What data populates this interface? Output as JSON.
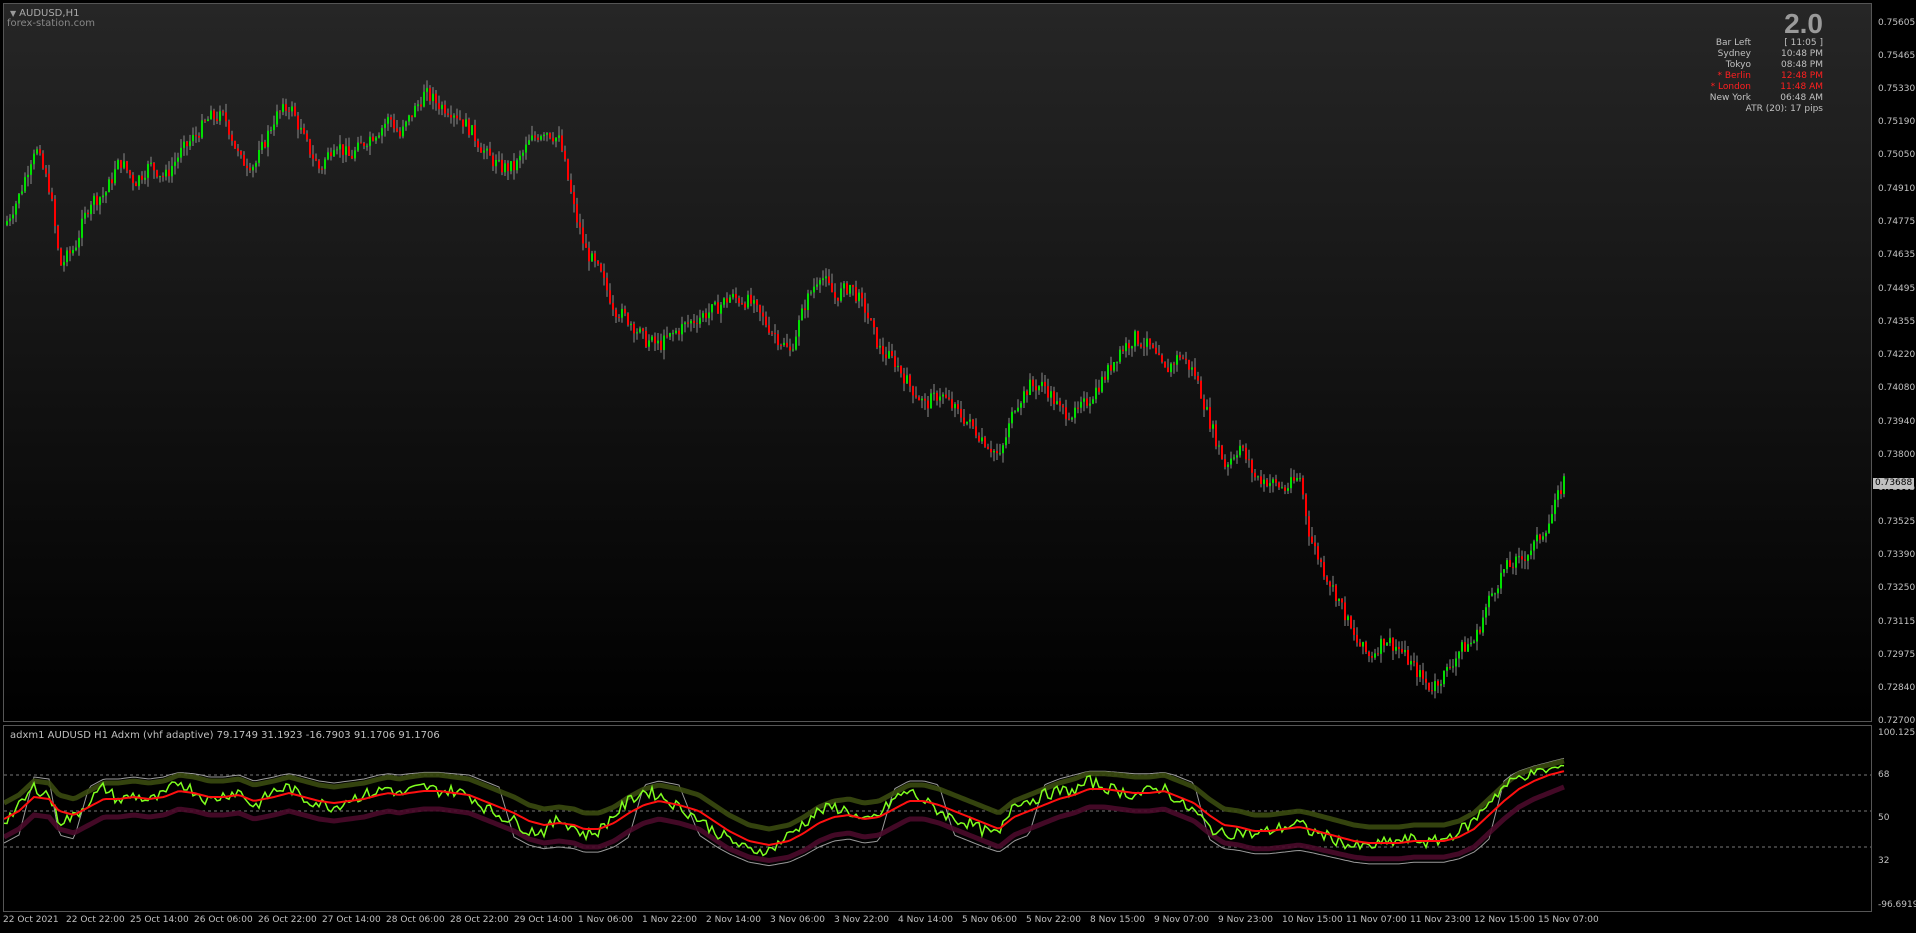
{
  "chart": {
    "symbol_title": "AUDUSD,H1",
    "site": "forex-station.com",
    "current_price": "0.73688",
    "price_axis": [
      "0.75605",
      "0.75465",
      "0.75330",
      "0.75190",
      "0.75050",
      "0.74910",
      "0.74775",
      "0.74635",
      "0.74495",
      "0.74355",
      "0.74220",
      "0.74080",
      "0.73940",
      "0.73800",
      "0.73665",
      "0.73525",
      "0.73390",
      "0.73250",
      "0.73115",
      "0.72975",
      "0.72840",
      "0.72700"
    ],
    "colors": {
      "up": "#00e000",
      "down": "#ff0000",
      "wick": "#888888",
      "grid": "#555555"
    }
  },
  "info_panel": {
    "big_value": "2.0",
    "rows": [
      {
        "label": "Bar Left",
        "value": "[ 11:05 ]",
        "color": "#c0c0c0"
      },
      {
        "label": "Sydney",
        "value": "10:48 PM",
        "color": "#c0c0c0"
      },
      {
        "label": "Tokyo",
        "value": "08:48 PM",
        "color": "#c0c0c0"
      },
      {
        "label": "* Berlin",
        "value": "12:48 PM",
        "color": "#ff2020"
      },
      {
        "label": "* London",
        "value": "11:48 AM",
        "color": "#ff2020"
      },
      {
        "label": "New York",
        "value": "06:48 AM",
        "color": "#c0c0c0"
      },
      {
        "label": "ATR (20): 17 pips",
        "value": "",
        "color": "#c0c0c0"
      }
    ]
  },
  "indicator": {
    "title": "adxm1 AUDUSD H1 Adxm (vhf adaptive) 79.1749 31.1923 -16.7903 91.1706 91.1706",
    "axis": [
      "100.1255",
      "68",
      "50",
      "32",
      "-96.6919"
    ],
    "levels": [
      68,
      50,
      32
    ],
    "colors": {
      "fast": "#80ff20",
      "slow": "#ff1010",
      "band_up": "#3a4a10",
      "band_dn": "#4a0a2a",
      "ref": "#9a9a9a"
    }
  },
  "time_axis": [
    "22 Oct 2021",
    "22 Oct 22:00",
    "25 Oct 14:00",
    "26 Oct 06:00",
    "26 Oct 22:00",
    "27 Oct 14:00",
    "28 Oct 06:00",
    "28 Oct 22:00",
    "29 Oct 14:00",
    "1 Nov 06:00",
    "1 Nov 22:00",
    "2 Nov 14:00",
    "3 Nov 06:00",
    "3 Nov 22:00",
    "4 Nov 14:00",
    "5 Nov 06:00",
    "5 Nov 22:00",
    "8 Nov 15:00",
    "9 Nov 07:00",
    "9 Nov 23:00",
    "10 Nov 15:00",
    "11 Nov 07:00",
    "11 Nov 23:00",
    "12 Nov 15:00",
    "15 Nov 07:00"
  ],
  "path_points": {
    "price": [
      [
        0,
        0.7475
      ],
      [
        15,
        0.7488
      ],
      [
        30,
        0.7508
      ],
      [
        45,
        0.749
      ],
      [
        55,
        0.7458
      ],
      [
        70,
        0.7466
      ],
      [
        85,
        0.7485
      ],
      [
        100,
        0.7488
      ],
      [
        115,
        0.7502
      ],
      [
        130,
        0.7493
      ],
      [
        145,
        0.75
      ],
      [
        160,
        0.7495
      ],
      [
        175,
        0.7505
      ],
      [
        190,
        0.7512
      ],
      [
        205,
        0.752
      ],
      [
        220,
        0.752
      ],
      [
        235,
        0.7502
      ],
      [
        250,
        0.75
      ],
      [
        270,
        0.752
      ],
      [
        285,
        0.7525
      ],
      [
        300,
        0.751
      ],
      [
        315,
        0.7498
      ],
      [
        330,
        0.751
      ],
      [
        345,
        0.7503
      ],
      [
        360,
        0.751
      ],
      [
        375,
        0.7515
      ],
      [
        385,
        0.752
      ],
      [
        395,
        0.7512
      ],
      [
        405,
        0.752
      ],
      [
        420,
        0.753
      ],
      [
        435,
        0.7525
      ],
      [
        450,
        0.7522
      ],
      [
        465,
        0.7515
      ],
      [
        480,
        0.7505
      ],
      [
        495,
        0.7499
      ],
      [
        510,
        0.7499
      ],
      [
        525,
        0.751
      ],
      [
        540,
        0.7515
      ],
      [
        555,
        0.751
      ],
      [
        570,
        0.748
      ],
      [
        580,
        0.7465
      ],
      [
        595,
        0.7455
      ],
      [
        610,
        0.744
      ],
      [
        625,
        0.7435
      ],
      [
        640,
        0.7427
      ],
      [
        655,
        0.7425
      ],
      [
        675,
        0.7432
      ],
      [
        695,
        0.7437
      ],
      [
        710,
        0.744
      ],
      [
        725,
        0.7445
      ],
      [
        745,
        0.7443
      ],
      [
        765,
        0.7432
      ],
      [
        785,
        0.7422
      ],
      [
        800,
        0.7442
      ],
      [
        815,
        0.7455
      ],
      [
        830,
        0.7445
      ],
      [
        845,
        0.745
      ],
      [
        860,
        0.744
      ],
      [
        875,
        0.7423
      ],
      [
        890,
        0.7418
      ],
      [
        905,
        0.7408
      ],
      [
        920,
        0.74
      ],
      [
        935,
        0.7405
      ],
      [
        950,
        0.7398
      ],
      [
        965,
        0.7392
      ],
      [
        980,
        0.7385
      ],
      [
        995,
        0.7378
      ],
      [
        1010,
        0.74
      ],
      [
        1025,
        0.7408
      ],
      [
        1040,
        0.7408
      ],
      [
        1055,
        0.7398
      ],
      [
        1070,
        0.7396
      ],
      [
        1085,
        0.7403
      ],
      [
        1100,
        0.7412
      ],
      [
        1115,
        0.7423
      ],
      [
        1130,
        0.7428
      ],
      [
        1145,
        0.7424
      ],
      [
        1160,
        0.7414
      ],
      [
        1175,
        0.7421
      ],
      [
        1190,
        0.7413
      ],
      [
        1205,
        0.7393
      ],
      [
        1220,
        0.7375
      ],
      [
        1235,
        0.7383
      ],
      [
        1250,
        0.737
      ],
      [
        1265,
        0.7368
      ],
      [
        1280,
        0.7365
      ],
      [
        1295,
        0.737
      ],
      [
        1305,
        0.7345
      ],
      [
        1320,
        0.733
      ],
      [
        1335,
        0.7318
      ],
      [
        1350,
        0.7302
      ],
      [
        1365,
        0.7295
      ],
      [
        1380,
        0.7303
      ],
      [
        1395,
        0.7298
      ],
      [
        1410,
        0.729
      ],
      [
        1425,
        0.7282
      ],
      [
        1440,
        0.7288
      ],
      [
        1455,
        0.7298
      ],
      [
        1470,
        0.7302
      ],
      [
        1485,
        0.732
      ],
      [
        1500,
        0.7332
      ],
      [
        1515,
        0.7335
      ],
      [
        1530,
        0.7342
      ],
      [
        1545,
        0.7352
      ],
      [
        1560,
        0.737
      ]
    ],
    "fast": [
      [
        0,
        45
      ],
      [
        15,
        52
      ],
      [
        30,
        62
      ],
      [
        45,
        58
      ],
      [
        55,
        45
      ],
      [
        70,
        47
      ],
      [
        85,
        55
      ],
      [
        100,
        62
      ],
      [
        115,
        55
      ],
      [
        130,
        58
      ],
      [
        145,
        55
      ],
      [
        160,
        58
      ],
      [
        175,
        65
      ],
      [
        190,
        60
      ],
      [
        205,
        55
      ],
      [
        220,
        58
      ],
      [
        235,
        60
      ],
      [
        250,
        52
      ],
      [
        270,
        60
      ],
      [
        285,
        62
      ],
      [
        300,
        56
      ],
      [
        315,
        54
      ],
      [
        330,
        52
      ],
      [
        345,
        56
      ],
      [
        360,
        58
      ],
      [
        375,
        60
      ],
      [
        385,
        62
      ],
      [
        395,
        58
      ],
      [
        405,
        60
      ],
      [
        420,
        62
      ],
      [
        435,
        60
      ],
      [
        450,
        60
      ],
      [
        465,
        58
      ],
      [
        480,
        52
      ],
      [
        495,
        48
      ],
      [
        510,
        45
      ],
      [
        525,
        40
      ],
      [
        540,
        40
      ],
      [
        555,
        46
      ],
      [
        570,
        42
      ],
      [
        580,
        38
      ],
      [
        595,
        40
      ],
      [
        610,
        48
      ],
      [
        625,
        55
      ],
      [
        640,
        60
      ],
      [
        655,
        58
      ],
      [
        675,
        52
      ],
      [
        695,
        46
      ],
      [
        710,
        40
      ],
      [
        725,
        36
      ],
      [
        745,
        30
      ],
      [
        765,
        30
      ],
      [
        785,
        38
      ],
      [
        800,
        44
      ],
      [
        815,
        50
      ],
      [
        830,
        52
      ],
      [
        845,
        50
      ],
      [
        860,
        44
      ],
      [
        875,
        48
      ],
      [
        890,
        56
      ],
      [
        905,
        60
      ],
      [
        920,
        55
      ],
      [
        935,
        50
      ],
      [
        950,
        46
      ],
      [
        965,
        44
      ],
      [
        980,
        40
      ],
      [
        995,
        38
      ],
      [
        1010,
        55
      ],
      [
        1025,
        55
      ],
      [
        1040,
        58
      ],
      [
        1055,
        60
      ],
      [
        1070,
        60
      ],
      [
        1085,
        65
      ],
      [
        1100,
        62
      ],
      [
        1115,
        60
      ],
      [
        1130,
        58
      ],
      [
        1145,
        60
      ],
      [
        1160,
        62
      ],
      [
        1175,
        54
      ],
      [
        1190,
        50
      ],
      [
        1205,
        42
      ],
      [
        1220,
        38
      ],
      [
        1235,
        40
      ],
      [
        1250,
        38
      ],
      [
        1265,
        40
      ],
      [
        1280,
        42
      ],
      [
        1295,
        44
      ],
      [
        1305,
        40
      ],
      [
        1320,
        38
      ],
      [
        1335,
        35
      ],
      [
        1350,
        32
      ],
      [
        1365,
        32
      ],
      [
        1380,
        34
      ],
      [
        1395,
        35
      ],
      [
        1410,
        36
      ],
      [
        1425,
        34
      ],
      [
        1440,
        36
      ],
      [
        1455,
        40
      ],
      [
        1470,
        45
      ],
      [
        1485,
        55
      ],
      [
        1500,
        62
      ],
      [
        1515,
        67
      ],
      [
        1530,
        70
      ],
      [
        1545,
        72
      ],
      [
        1560,
        75
      ]
    ],
    "slow": [
      [
        0,
        46
      ],
      [
        15,
        50
      ],
      [
        30,
        57
      ],
      [
        45,
        56
      ],
      [
        55,
        50
      ],
      [
        70,
        48
      ],
      [
        85,
        52
      ],
      [
        100,
        56
      ],
      [
        115,
        56
      ],
      [
        130,
        57
      ],
      [
        145,
        56
      ],
      [
        160,
        57
      ],
      [
        175,
        60
      ],
      [
        190,
        59
      ],
      [
        205,
        57
      ],
      [
        220,
        57
      ],
      [
        235,
        58
      ],
      [
        250,
        55
      ],
      [
        270,
        57
      ],
      [
        285,
        59
      ],
      [
        300,
        57
      ],
      [
        315,
        55
      ],
      [
        330,
        54
      ],
      [
        345,
        55
      ],
      [
        360,
        56
      ],
      [
        375,
        58
      ],
      [
        385,
        59
      ],
      [
        395,
        58
      ],
      [
        405,
        59
      ],
      [
        420,
        60
      ],
      [
        435,
        60
      ],
      [
        450,
        59
      ],
      [
        465,
        58
      ],
      [
        480,
        55
      ],
      [
        495,
        52
      ],
      [
        510,
        49
      ],
      [
        525,
        45
      ],
      [
        540,
        43
      ],
      [
        555,
        44
      ],
      [
        570,
        43
      ],
      [
        580,
        41
      ],
      [
        595,
        41
      ],
      [
        610,
        44
      ],
      [
        625,
        49
      ],
      [
        640,
        53
      ],
      [
        655,
        55
      ],
      [
        675,
        53
      ],
      [
        695,
        50
      ],
      [
        710,
        45
      ],
      [
        725,
        40
      ],
      [
        745,
        35
      ],
      [
        765,
        33
      ],
      [
        785,
        35
      ],
      [
        800,
        39
      ],
      [
        815,
        44
      ],
      [
        830,
        47
      ],
      [
        845,
        48
      ],
      [
        860,
        46
      ],
      [
        875,
        47
      ],
      [
        890,
        51
      ],
      [
        905,
        55
      ],
      [
        920,
        55
      ],
      [
        935,
        53
      ],
      [
        950,
        50
      ],
      [
        965,
        47
      ],
      [
        980,
        44
      ],
      [
        995,
        41
      ],
      [
        1010,
        47
      ],
      [
        1025,
        50
      ],
      [
        1040,
        53
      ],
      [
        1055,
        56
      ],
      [
        1070,
        58
      ],
      [
        1085,
        61
      ],
      [
        1100,
        61
      ],
      [
        1115,
        60
      ],
      [
        1130,
        59
      ],
      [
        1145,
        59
      ],
      [
        1160,
        60
      ],
      [
        1175,
        57
      ],
      [
        1190,
        54
      ],
      [
        1205,
        48
      ],
      [
        1220,
        43
      ],
      [
        1235,
        42
      ],
      [
        1250,
        40
      ],
      [
        1265,
        40
      ],
      [
        1280,
        41
      ],
      [
        1295,
        42
      ],
      [
        1305,
        41
      ],
      [
        1320,
        39
      ],
      [
        1335,
        37
      ],
      [
        1350,
        35
      ],
      [
        1365,
        34
      ],
      [
        1380,
        34
      ],
      [
        1395,
        34
      ],
      [
        1410,
        35
      ],
      [
        1425,
        35
      ],
      [
        1440,
        35
      ],
      [
        1455,
        37
      ],
      [
        1470,
        41
      ],
      [
        1485,
        48
      ],
      [
        1500,
        55
      ],
      [
        1515,
        61
      ],
      [
        1530,
        65
      ],
      [
        1545,
        68
      ],
      [
        1560,
        71
      ]
    ]
  }
}
